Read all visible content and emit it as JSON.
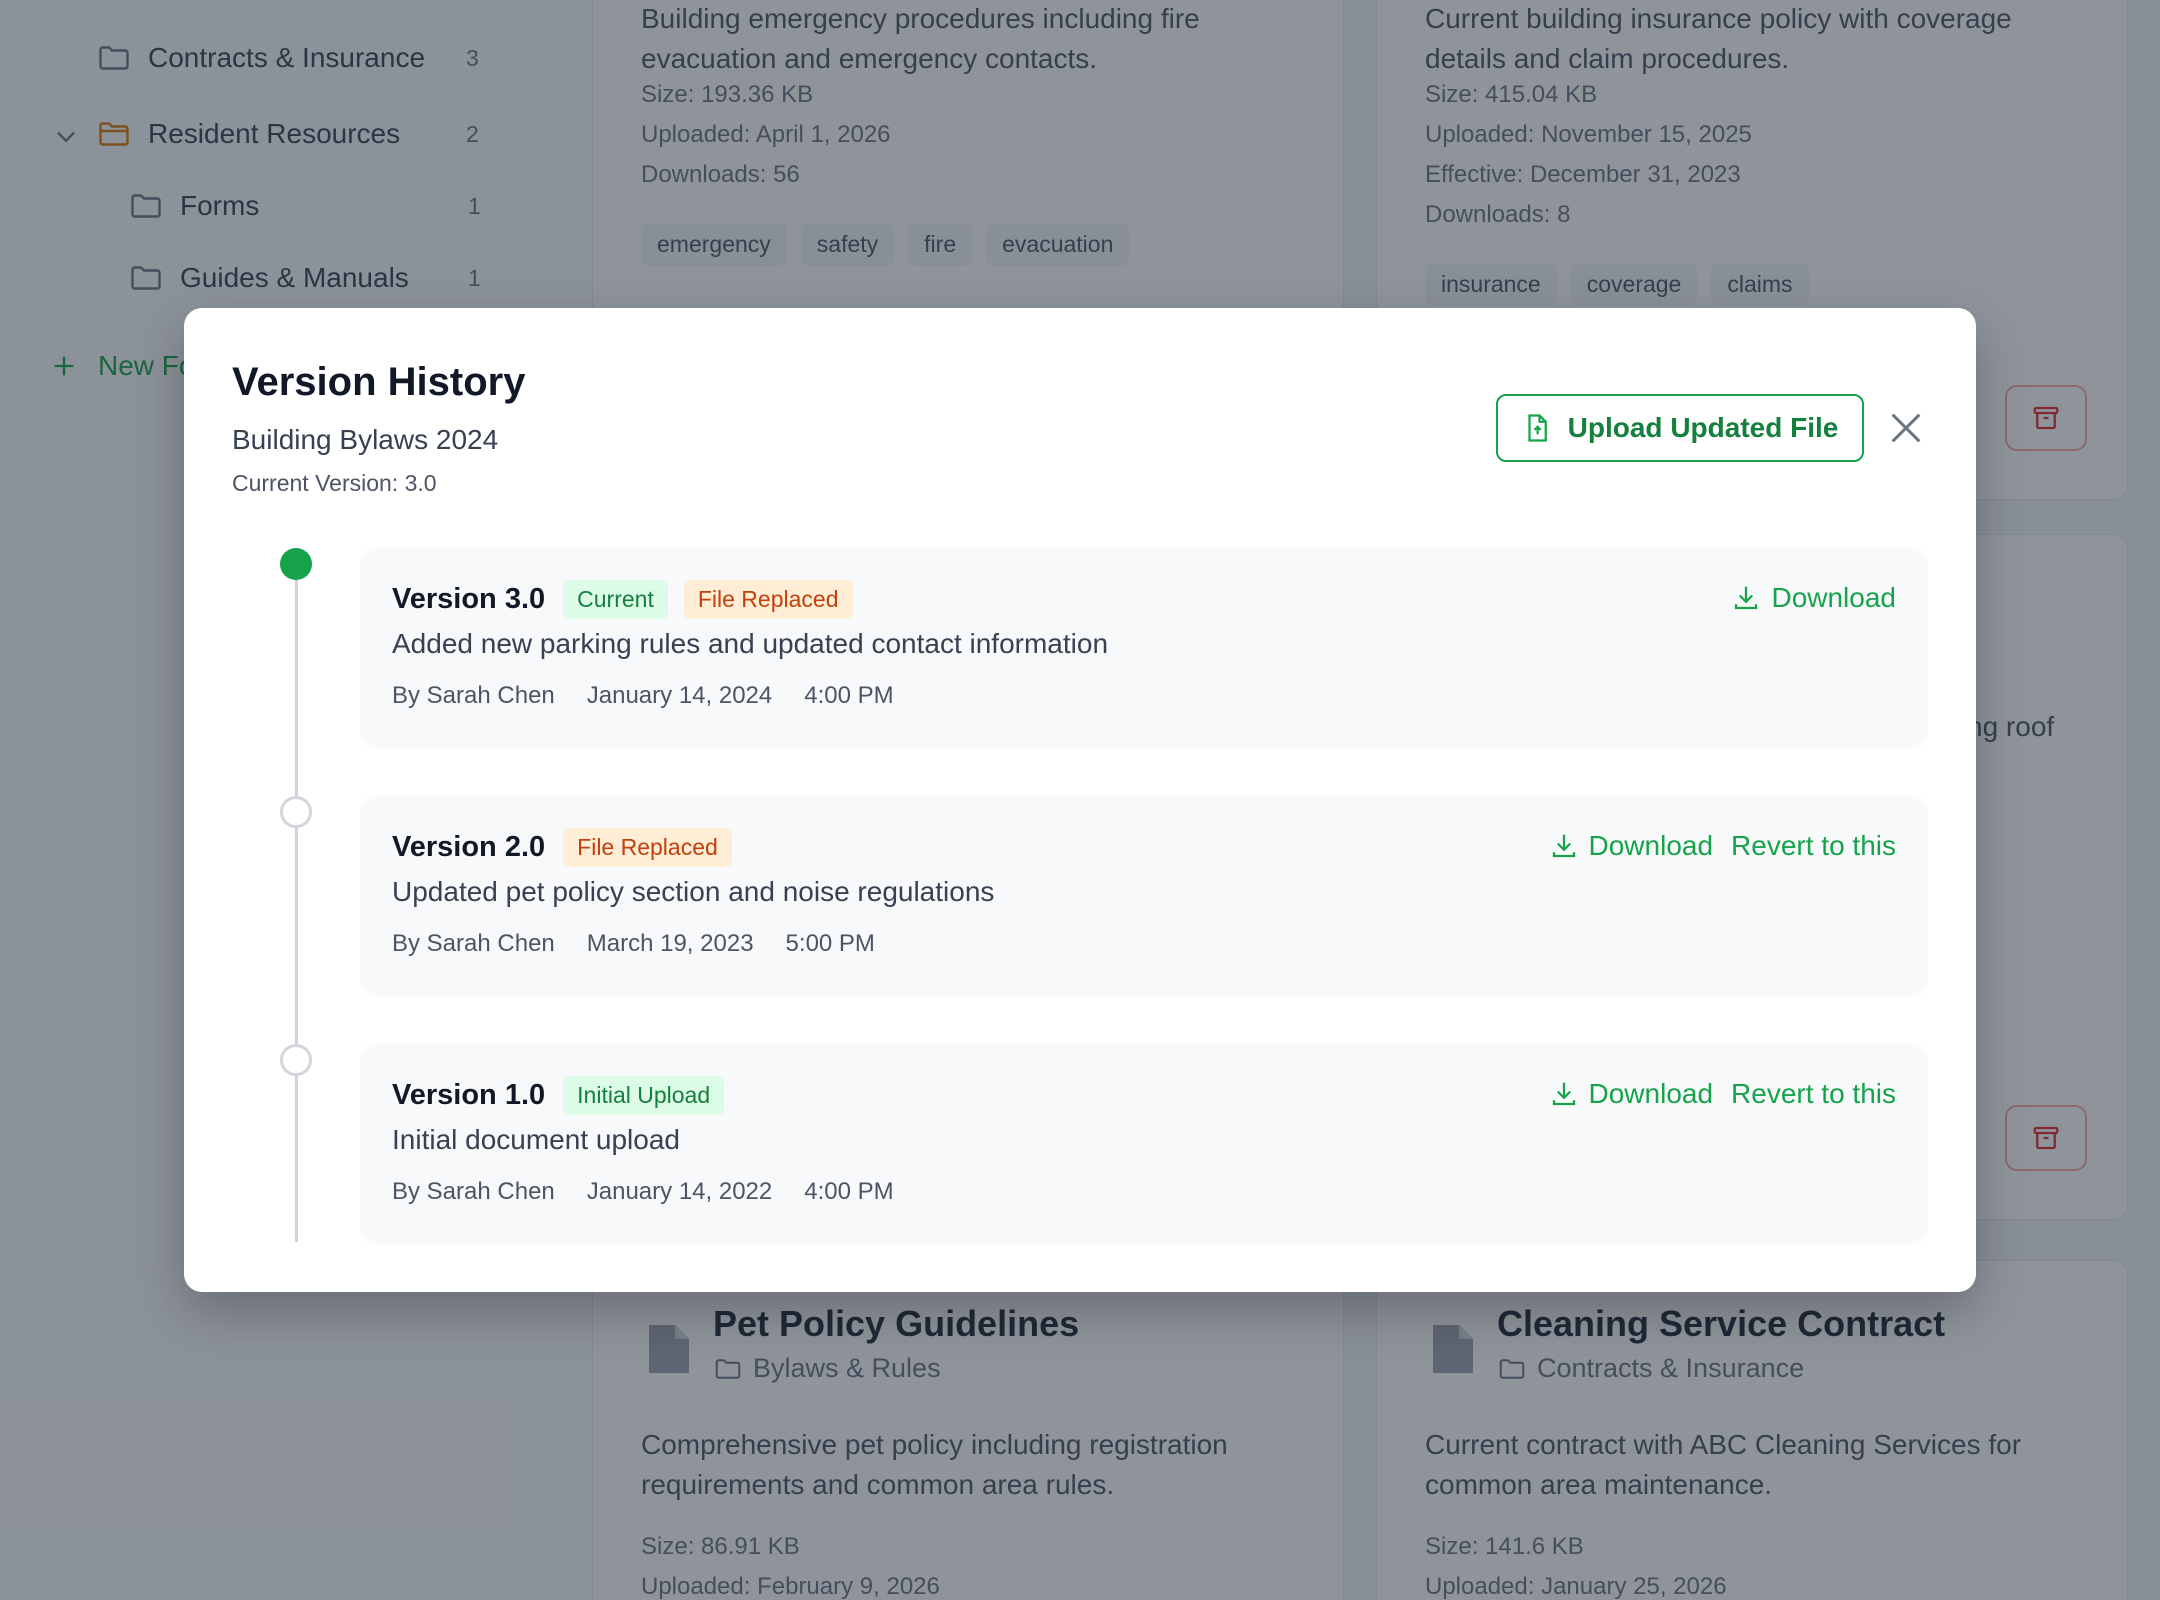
{
  "sidebar": {
    "items": [
      {
        "label": "Contracts & Insurance",
        "count": "3"
      },
      {
        "label": "Resident Resources",
        "count": "2"
      },
      {
        "label": "Forms",
        "count": "1"
      },
      {
        "label": "Guides & Manuals",
        "count": "1"
      }
    ],
    "new_folder_label": "New Fo"
  },
  "cards": {
    "emergency": {
      "desc": "Building emergency procedures including fire evacuation and emergency contacts.",
      "size": "Size: 193.36 KB",
      "uploaded": "Uploaded: April 1, 2026",
      "downloads": "Downloads: 56",
      "tags": [
        "emergency",
        "safety",
        "fire",
        "evacuation"
      ]
    },
    "insurance": {
      "desc": "Current building insurance policy with coverage details and claim procedures.",
      "size": "Size: 415.04 KB",
      "uploaded": "Uploaded: November 15, 2025",
      "effective": "Effective: December 31, 2023",
      "downloads": "Downloads: 8",
      "tags": [
        "insurance",
        "coverage",
        "claims"
      ]
    },
    "roof_partial": "ng roof",
    "pet": {
      "title": "Pet Policy Guidelines",
      "folder": "Bylaws & Rules",
      "desc": "Comprehensive pet policy including registration requirements and common area rules.",
      "size": "Size: 86.91 KB",
      "uploaded": "Uploaded: February 9, 2026"
    },
    "cleaning": {
      "title": "Cleaning Service Contract",
      "folder": "Contracts & Insurance",
      "desc": "Current contract with ABC Cleaning Services for common area maintenance.",
      "size": "Size: 141.6 KB",
      "uploaded": "Uploaded: January 25, 2026"
    }
  },
  "modal": {
    "title": "Version History",
    "subtitle": "Building Bylaws 2024",
    "current_version": "Current Version: 3.0",
    "upload_label": "Upload Updated File",
    "versions": [
      {
        "name": "Version 3.0",
        "badges": [
          "Current",
          "File Replaced"
        ],
        "desc": "Added new parking rules and updated contact information",
        "author": "By Sarah Chen",
        "date": "January 14, 2024",
        "time": "4:00 PM",
        "download_label": "Download"
      },
      {
        "name": "Version 2.0",
        "badges": [
          "File Replaced"
        ],
        "desc": "Updated pet policy section and noise regulations",
        "author": "By Sarah Chen",
        "date": "March 19, 2023",
        "time": "5:00 PM",
        "download_label": "Download",
        "revert_label": "Revert to this"
      },
      {
        "name": "Version 1.0",
        "badges": [
          "Initial Upload"
        ],
        "desc": "Initial document upload",
        "author": "By Sarah Chen",
        "date": "January 14, 2022",
        "time": "4:00 PM",
        "download_label": "Download",
        "revert_label": "Revert to this"
      }
    ]
  },
  "colors": {
    "accent": "#16a34a",
    "badge_orange": "#c2410c",
    "overlay": "rgba(31,41,55,0.5)"
  }
}
